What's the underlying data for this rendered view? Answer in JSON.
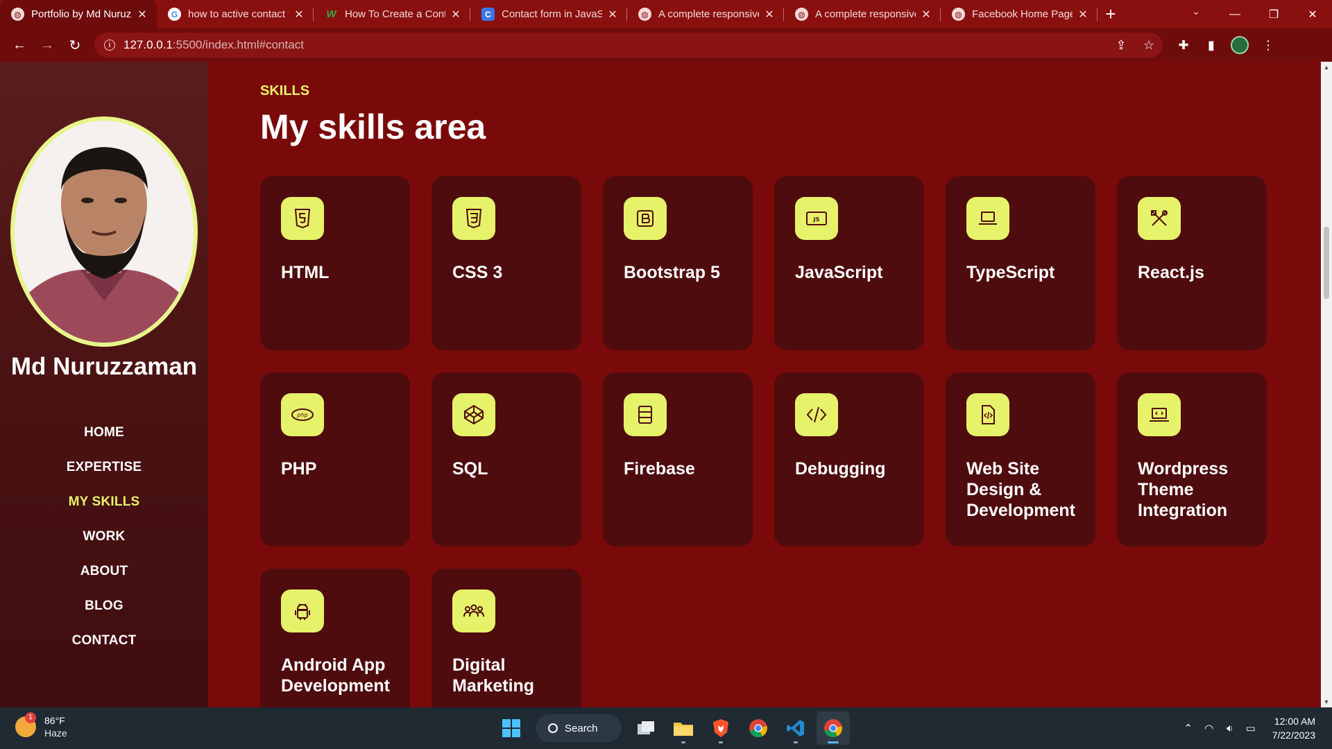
{
  "browser": {
    "tabs": [
      {
        "title": "Portfolio by Md Nuruzzaman",
        "icon": "globe-icon",
        "active": true
      },
      {
        "title": "how to active contact form",
        "icon": "google-icon",
        "active": false
      },
      {
        "title": "How To Create a Contact Form",
        "icon": "w-icon",
        "active": false
      },
      {
        "title": "Contact form in JavaScript",
        "icon": "c-icon",
        "active": false
      },
      {
        "title": "A complete responsive website",
        "icon": "globe-icon",
        "active": false
      },
      {
        "title": "A complete responsive website",
        "icon": "globe-icon",
        "active": false
      },
      {
        "title": "Facebook Home Page",
        "icon": "globe-icon",
        "active": false
      }
    ],
    "url_host": "127.0.0.1",
    "url_rest": ":5500/index.html#contact"
  },
  "sidebar": {
    "name": "Md Nuruzzaman",
    "menu": [
      {
        "label": "HOME",
        "active": false
      },
      {
        "label": "EXPERTISE",
        "active": false
      },
      {
        "label": "MY SKILLS",
        "active": true
      },
      {
        "label": "WORK",
        "active": false
      },
      {
        "label": "ABOUT",
        "active": false
      },
      {
        "label": "BLOG",
        "active": false
      },
      {
        "label": "CONTACT",
        "active": false
      }
    ]
  },
  "skills": {
    "eyebrow": "SKILLS",
    "headline": "My skills area",
    "items": [
      {
        "title": "HTML",
        "icon": "html5-icon"
      },
      {
        "title": "CSS 3",
        "icon": "css3-icon"
      },
      {
        "title": "Bootstrap 5",
        "icon": "bootstrap-icon"
      },
      {
        "title": "JavaScript",
        "icon": "js-icon"
      },
      {
        "title": "TypeScript",
        "icon": "laptop-icon"
      },
      {
        "title": "React.js",
        "icon": "tools-icon"
      },
      {
        "title": "PHP",
        "icon": "php-icon"
      },
      {
        "title": "SQL",
        "icon": "codepen-icon"
      },
      {
        "title": "Firebase",
        "icon": "layout-icon"
      },
      {
        "title": "Debugging",
        "icon": "code-icon"
      },
      {
        "title": "Web Site Design & Development",
        "icon": "file-code-icon"
      },
      {
        "title": "Wordpress Theme Integration",
        "icon": "laptop-code-icon"
      },
      {
        "title": "Android App Development",
        "icon": "android-icon"
      },
      {
        "title": "Digital Marketing",
        "icon": "people-icon"
      }
    ]
  },
  "taskbar": {
    "weather_temp": "86°F",
    "weather_cond": "Haze",
    "weather_badge": "1",
    "search_label": "Search",
    "time": "12:00 AM",
    "date": "7/22/2023"
  },
  "colors": {
    "page_bg": "#7a0a0a",
    "card_bg": "#4f0c0e",
    "accent": "#e6f26a",
    "chrome_bg": "#8a0f0f"
  }
}
